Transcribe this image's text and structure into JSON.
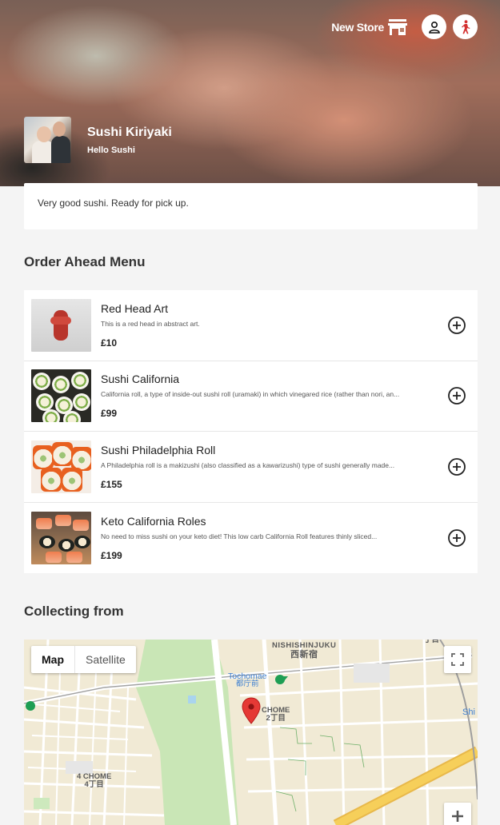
{
  "header": {
    "store_link_label": "New Store",
    "store_name": "Sushi Kiriyaki",
    "store_tagline": "Hello Sushi"
  },
  "description": "Very good sushi. Ready for pick up.",
  "menu": {
    "title": "Order Ahead Menu",
    "items": [
      {
        "name": "Red Head Art",
        "description": "This is a red head in abstract art.",
        "price": "£10"
      },
      {
        "name": "Sushi California",
        "description": "California roll, a type of inside-out sushi roll (uramaki) in which vinegared rice (rather than nori, an...",
        "price": "£99"
      },
      {
        "name": "Sushi Philadelphia Roll",
        "description": "A Philadelphia roll is a makizushi (also classified as a kawarizushi) type of sushi generally made...",
        "price": "£155"
      },
      {
        "name": "Keto California Roles",
        "description": "No need to miss sushi on your keto diet! This low carb California Roll features thinly sliced...",
        "price": "£199"
      }
    ]
  },
  "collecting": {
    "title": "Collecting from"
  },
  "map": {
    "tab_map": "Map",
    "tab_satellite": "Satellite",
    "labels": {
      "nishishinjuku": "NISHISHINJUKU",
      "nishishinjuku_jp": "西新宿",
      "tochomae": "Tochomae",
      "tochomae_jp": "都庁前",
      "chome2": "CHOME",
      "chome2_jp": "2丁目",
      "chome4": "4 CHOME",
      "chome4_jp": "4丁目",
      "chome1_jp": "丁目",
      "shi": "Shi"
    }
  },
  "colors": {
    "pin": "#e53935",
    "park": "#c5e8b4",
    "road": "#ffffff",
    "highway": "#f6c94f"
  }
}
